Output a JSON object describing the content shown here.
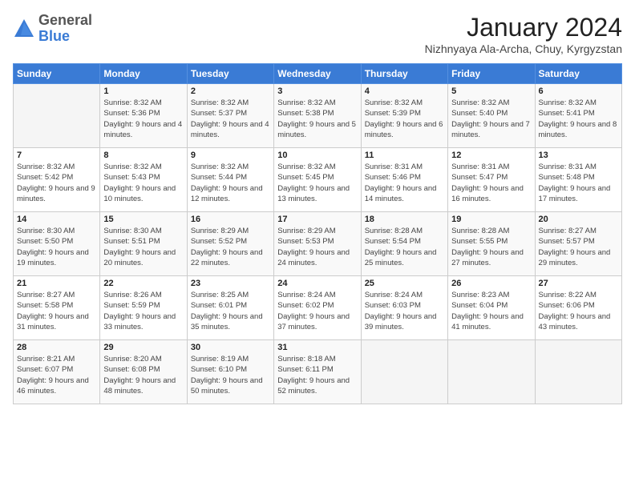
{
  "header": {
    "logo_general": "General",
    "logo_blue": "Blue",
    "title": "January 2024",
    "subtitle": "Nizhnyaya Ala-Archa, Chuy, Kyrgyzstan"
  },
  "days_of_week": [
    "Sunday",
    "Monday",
    "Tuesday",
    "Wednesday",
    "Thursday",
    "Friday",
    "Saturday"
  ],
  "weeks": [
    [
      {
        "day": "",
        "sunrise": "",
        "sunset": "",
        "daylight": ""
      },
      {
        "day": "1",
        "sunrise": "Sunrise: 8:32 AM",
        "sunset": "Sunset: 5:36 PM",
        "daylight": "Daylight: 9 hours and 4 minutes."
      },
      {
        "day": "2",
        "sunrise": "Sunrise: 8:32 AM",
        "sunset": "Sunset: 5:37 PM",
        "daylight": "Daylight: 9 hours and 4 minutes."
      },
      {
        "day": "3",
        "sunrise": "Sunrise: 8:32 AM",
        "sunset": "Sunset: 5:38 PM",
        "daylight": "Daylight: 9 hours and 5 minutes."
      },
      {
        "day": "4",
        "sunrise": "Sunrise: 8:32 AM",
        "sunset": "Sunset: 5:39 PM",
        "daylight": "Daylight: 9 hours and 6 minutes."
      },
      {
        "day": "5",
        "sunrise": "Sunrise: 8:32 AM",
        "sunset": "Sunset: 5:40 PM",
        "daylight": "Daylight: 9 hours and 7 minutes."
      },
      {
        "day": "6",
        "sunrise": "Sunrise: 8:32 AM",
        "sunset": "Sunset: 5:41 PM",
        "daylight": "Daylight: 9 hours and 8 minutes."
      }
    ],
    [
      {
        "day": "7",
        "sunrise": "Sunrise: 8:32 AM",
        "sunset": "Sunset: 5:42 PM",
        "daylight": "Daylight: 9 hours and 9 minutes."
      },
      {
        "day": "8",
        "sunrise": "Sunrise: 8:32 AM",
        "sunset": "Sunset: 5:43 PM",
        "daylight": "Daylight: 9 hours and 10 minutes."
      },
      {
        "day": "9",
        "sunrise": "Sunrise: 8:32 AM",
        "sunset": "Sunset: 5:44 PM",
        "daylight": "Daylight: 9 hours and 12 minutes."
      },
      {
        "day": "10",
        "sunrise": "Sunrise: 8:32 AM",
        "sunset": "Sunset: 5:45 PM",
        "daylight": "Daylight: 9 hours and 13 minutes."
      },
      {
        "day": "11",
        "sunrise": "Sunrise: 8:31 AM",
        "sunset": "Sunset: 5:46 PM",
        "daylight": "Daylight: 9 hours and 14 minutes."
      },
      {
        "day": "12",
        "sunrise": "Sunrise: 8:31 AM",
        "sunset": "Sunset: 5:47 PM",
        "daylight": "Daylight: 9 hours and 16 minutes."
      },
      {
        "day": "13",
        "sunrise": "Sunrise: 8:31 AM",
        "sunset": "Sunset: 5:48 PM",
        "daylight": "Daylight: 9 hours and 17 minutes."
      }
    ],
    [
      {
        "day": "14",
        "sunrise": "Sunrise: 8:30 AM",
        "sunset": "Sunset: 5:50 PM",
        "daylight": "Daylight: 9 hours and 19 minutes."
      },
      {
        "day": "15",
        "sunrise": "Sunrise: 8:30 AM",
        "sunset": "Sunset: 5:51 PM",
        "daylight": "Daylight: 9 hours and 20 minutes."
      },
      {
        "day": "16",
        "sunrise": "Sunrise: 8:29 AM",
        "sunset": "Sunset: 5:52 PM",
        "daylight": "Daylight: 9 hours and 22 minutes."
      },
      {
        "day": "17",
        "sunrise": "Sunrise: 8:29 AM",
        "sunset": "Sunset: 5:53 PM",
        "daylight": "Daylight: 9 hours and 24 minutes."
      },
      {
        "day": "18",
        "sunrise": "Sunrise: 8:28 AM",
        "sunset": "Sunset: 5:54 PM",
        "daylight": "Daylight: 9 hours and 25 minutes."
      },
      {
        "day": "19",
        "sunrise": "Sunrise: 8:28 AM",
        "sunset": "Sunset: 5:55 PM",
        "daylight": "Daylight: 9 hours and 27 minutes."
      },
      {
        "day": "20",
        "sunrise": "Sunrise: 8:27 AM",
        "sunset": "Sunset: 5:57 PM",
        "daylight": "Daylight: 9 hours and 29 minutes."
      }
    ],
    [
      {
        "day": "21",
        "sunrise": "Sunrise: 8:27 AM",
        "sunset": "Sunset: 5:58 PM",
        "daylight": "Daylight: 9 hours and 31 minutes."
      },
      {
        "day": "22",
        "sunrise": "Sunrise: 8:26 AM",
        "sunset": "Sunset: 5:59 PM",
        "daylight": "Daylight: 9 hours and 33 minutes."
      },
      {
        "day": "23",
        "sunrise": "Sunrise: 8:25 AM",
        "sunset": "Sunset: 6:01 PM",
        "daylight": "Daylight: 9 hours and 35 minutes."
      },
      {
        "day": "24",
        "sunrise": "Sunrise: 8:24 AM",
        "sunset": "Sunset: 6:02 PM",
        "daylight": "Daylight: 9 hours and 37 minutes."
      },
      {
        "day": "25",
        "sunrise": "Sunrise: 8:24 AM",
        "sunset": "Sunset: 6:03 PM",
        "daylight": "Daylight: 9 hours and 39 minutes."
      },
      {
        "day": "26",
        "sunrise": "Sunrise: 8:23 AM",
        "sunset": "Sunset: 6:04 PM",
        "daylight": "Daylight: 9 hours and 41 minutes."
      },
      {
        "day": "27",
        "sunrise": "Sunrise: 8:22 AM",
        "sunset": "Sunset: 6:06 PM",
        "daylight": "Daylight: 9 hours and 43 minutes."
      }
    ],
    [
      {
        "day": "28",
        "sunrise": "Sunrise: 8:21 AM",
        "sunset": "Sunset: 6:07 PM",
        "daylight": "Daylight: 9 hours and 46 minutes."
      },
      {
        "day": "29",
        "sunrise": "Sunrise: 8:20 AM",
        "sunset": "Sunset: 6:08 PM",
        "daylight": "Daylight: 9 hours and 48 minutes."
      },
      {
        "day": "30",
        "sunrise": "Sunrise: 8:19 AM",
        "sunset": "Sunset: 6:10 PM",
        "daylight": "Daylight: 9 hours and 50 minutes."
      },
      {
        "day": "31",
        "sunrise": "Sunrise: 8:18 AM",
        "sunset": "Sunset: 6:11 PM",
        "daylight": "Daylight: 9 hours and 52 minutes."
      },
      {
        "day": "",
        "sunrise": "",
        "sunset": "",
        "daylight": ""
      },
      {
        "day": "",
        "sunrise": "",
        "sunset": "",
        "daylight": ""
      },
      {
        "day": "",
        "sunrise": "",
        "sunset": "",
        "daylight": ""
      }
    ]
  ]
}
